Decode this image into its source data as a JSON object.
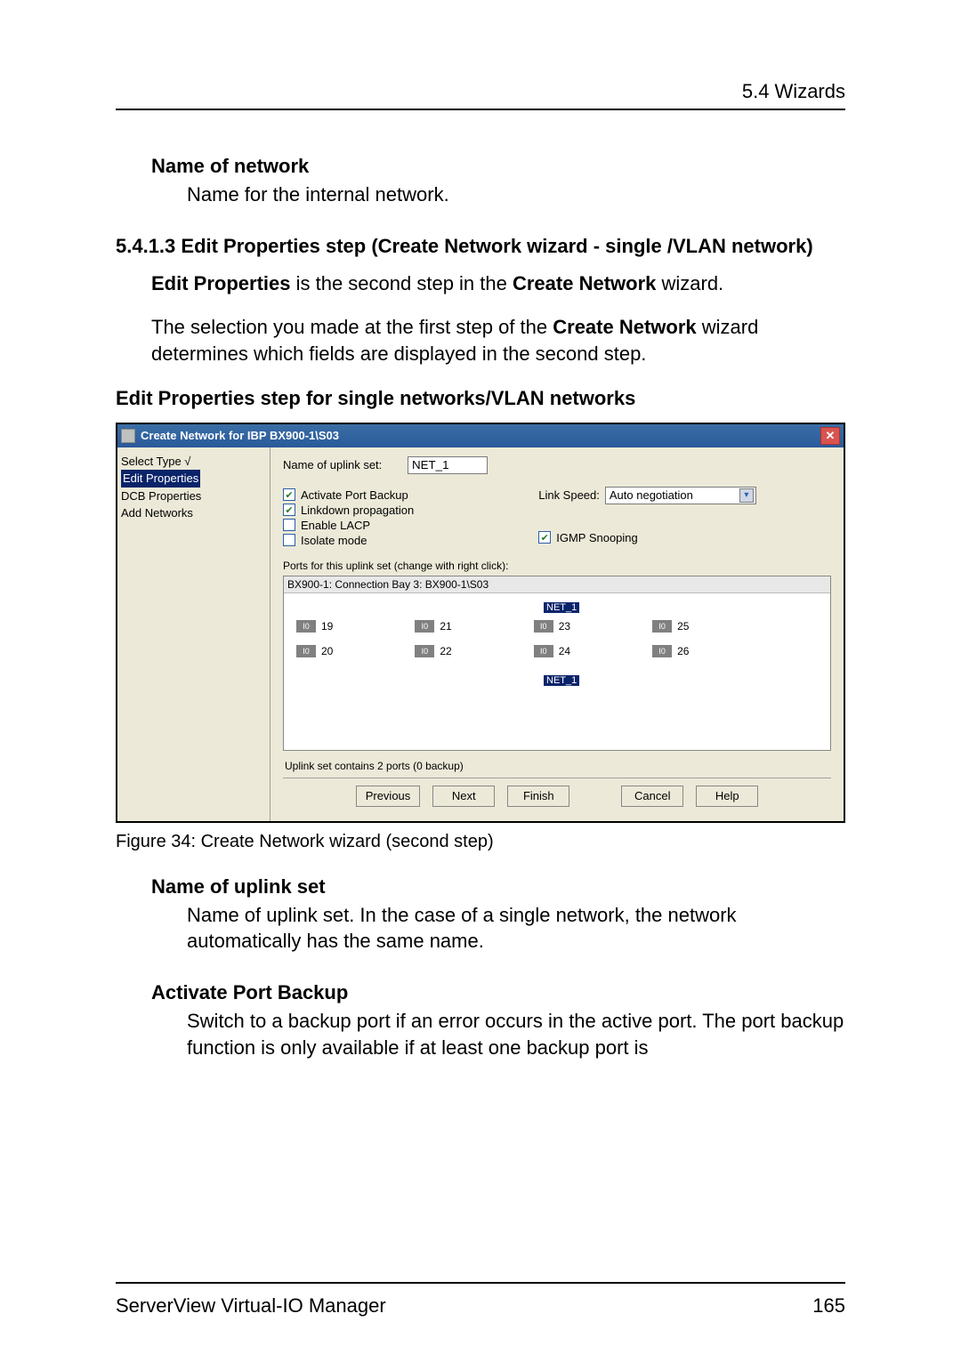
{
  "header": {
    "section": "5.4 Wizards"
  },
  "sec1": {
    "term": "Name of network",
    "def": "Name for the internal network."
  },
  "h5413": {
    "num_title": "5.4.1.3  Edit Properties step (Create Network wizard - single /VLAN network)",
    "p1_a": "Edit Properties",
    "p1_b": " is the second step in the ",
    "p1_c": "Create Network",
    "p1_d": " wizard.",
    "p2_a": "The selection you made at the first step of the ",
    "p2_b": "Create Network",
    "p2_c": " wizard determines which fields are displayed in the second step.",
    "sub": "Edit Properties step for single networks/VLAN networks"
  },
  "dialog": {
    "title": "Create Network for IBP BX900-1\\S03",
    "tree": {
      "items": [
        "Select Type √",
        "Edit Properties",
        "DCB Properties",
        "Add Networks"
      ],
      "selected_index": 1
    },
    "form": {
      "name_label": "Name of uplink set:",
      "name_value": "NET_1",
      "activate_port_backup": {
        "label": "Activate Port Backup",
        "checked": true
      },
      "linkdown_propagation": {
        "label": "Linkdown propagation",
        "checked": true
      },
      "enable_lacp": {
        "label": "Enable LACP",
        "checked": false
      },
      "isolate_mode": {
        "label": "Isolate mode",
        "checked": false
      },
      "link_speed_label": "Link Speed:",
      "link_speed_value": "Auto negotiation",
      "igmp_snooping": {
        "label": "IGMP Snooping",
        "checked": true
      },
      "ports_caption": "Ports for this uplink set (change with right click):",
      "ports_header": "BX900-1: Connection Bay 3: BX900-1\\S03",
      "net_tag": "NET_1",
      "port_led": "I0",
      "ports_row1": [
        "19",
        "21",
        "23",
        "25"
      ],
      "ports_row2": [
        "20",
        "22",
        "24",
        "26"
      ],
      "summary": "Uplink set contains 2 ports (0 backup)"
    },
    "buttons": {
      "previous": "Previous",
      "next": "Next",
      "finish": "Finish",
      "cancel": "Cancel",
      "help": "Help"
    }
  },
  "figcap": "Figure 34: Create Network wizard (second step)",
  "sec2": {
    "term": "Name of uplink set",
    "def": "Name of uplink set. In the case of a single network, the network automatically has the same name."
  },
  "sec3": {
    "term": "Activate Port Backup",
    "def": "Switch to a backup port if an error occurs in the active port. The port backup function is only available if at least one backup port is"
  },
  "footer": {
    "left": "ServerView Virtual-IO Manager",
    "right": "165"
  }
}
